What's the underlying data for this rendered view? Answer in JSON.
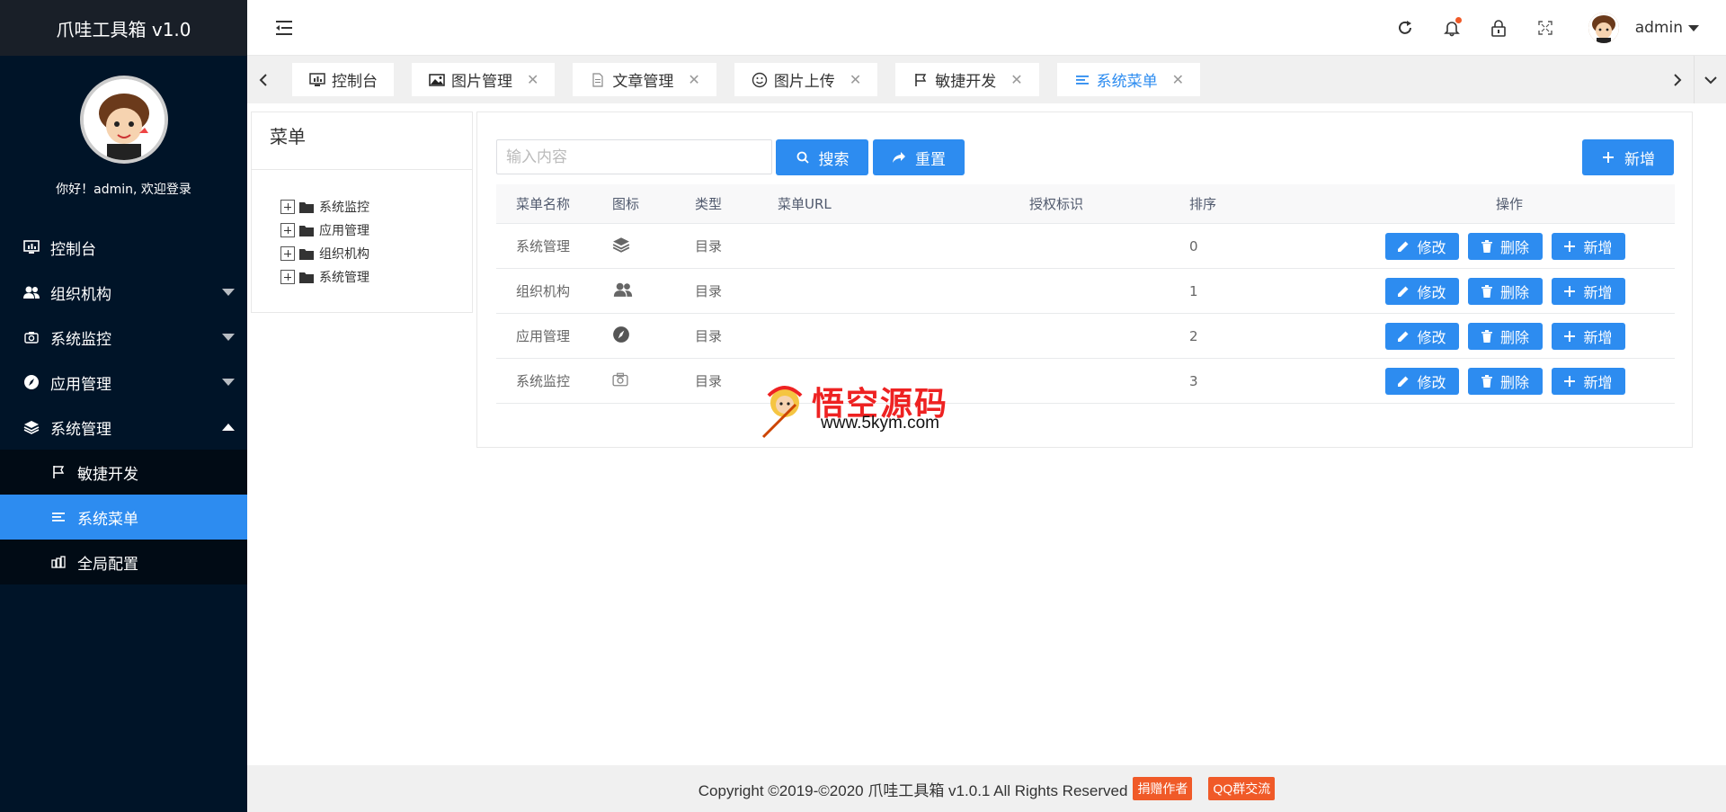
{
  "app": {
    "title": "爪哇工具箱 v1.0"
  },
  "profile": {
    "welcome": "你好！admin, 欢迎登录"
  },
  "sidebar": {
    "items": [
      {
        "label": "控制台",
        "icon": "dashboard-icon"
      },
      {
        "label": "组织机构",
        "icon": "users-icon",
        "expandable": true
      },
      {
        "label": "系统监控",
        "icon": "camera-icon",
        "expandable": true
      },
      {
        "label": "应用管理",
        "icon": "compass-icon",
        "expandable": true
      },
      {
        "label": "系统管理",
        "icon": "layers-icon",
        "expandable": true,
        "expanded": true
      }
    ],
    "sub_items": [
      {
        "label": "敏捷开发",
        "icon": "flag-icon"
      },
      {
        "label": "系统菜单",
        "icon": "menu-list-icon",
        "active": true
      },
      {
        "label": "全局配置",
        "icon": "config-icon"
      }
    ]
  },
  "header": {
    "username": "admin"
  },
  "tabs": [
    {
      "label": "控制台",
      "icon": "monitor-icon",
      "closable": false
    },
    {
      "label": "图片管理",
      "icon": "image-icon",
      "closable": true
    },
    {
      "label": "文章管理",
      "icon": "document-icon",
      "closable": true
    },
    {
      "label": "图片上传",
      "icon": "smile-icon",
      "closable": true
    },
    {
      "label": "敏捷开发",
      "icon": "flag-icon",
      "closable": true
    },
    {
      "label": "系统菜单",
      "icon": "menu-list-icon",
      "closable": true,
      "active": true
    }
  ],
  "tab_close_glyph": "✕",
  "tree": {
    "title": "菜单",
    "nodes": [
      "系统监控",
      "应用管理",
      "组织机构",
      "系统管理"
    ]
  },
  "toolbar": {
    "search_placeholder": "输入内容",
    "search_label": "搜索",
    "reset_label": "重置",
    "add_label": "新增"
  },
  "table": {
    "headers": [
      "菜单名称",
      "图标",
      "类型",
      "菜单URL",
      "授权标识",
      "排序",
      "操作"
    ],
    "rows": [
      {
        "name": "系统管理",
        "icon": "layers-icon",
        "type": "目录",
        "url": "",
        "perm": "",
        "order": "0"
      },
      {
        "name": "组织机构",
        "icon": "users-icon",
        "type": "目录",
        "url": "",
        "perm": "",
        "order": "1"
      },
      {
        "name": "应用管理",
        "icon": "compass-icon",
        "type": "目录",
        "url": "",
        "perm": "",
        "order": "2"
      },
      {
        "name": "系统监控",
        "icon": "camera-icon",
        "type": "目录",
        "url": "",
        "perm": "",
        "order": "3"
      }
    ],
    "actions": {
      "edit": "修改",
      "delete": "删除",
      "add": "新增"
    }
  },
  "watermark": {
    "title": "悟空源码",
    "url": "www.5kym.com"
  },
  "footer": {
    "copyright": "Copyright ©2019-©2020 爪哇工具箱 v1.0.1 All Rights Reserved",
    "donate": "捐赠作者",
    "qq": "QQ群交流"
  },
  "colors": {
    "primary": "#2d8cf0",
    "sidebar_bg": "#001428",
    "badge": "#f05a28"
  }
}
